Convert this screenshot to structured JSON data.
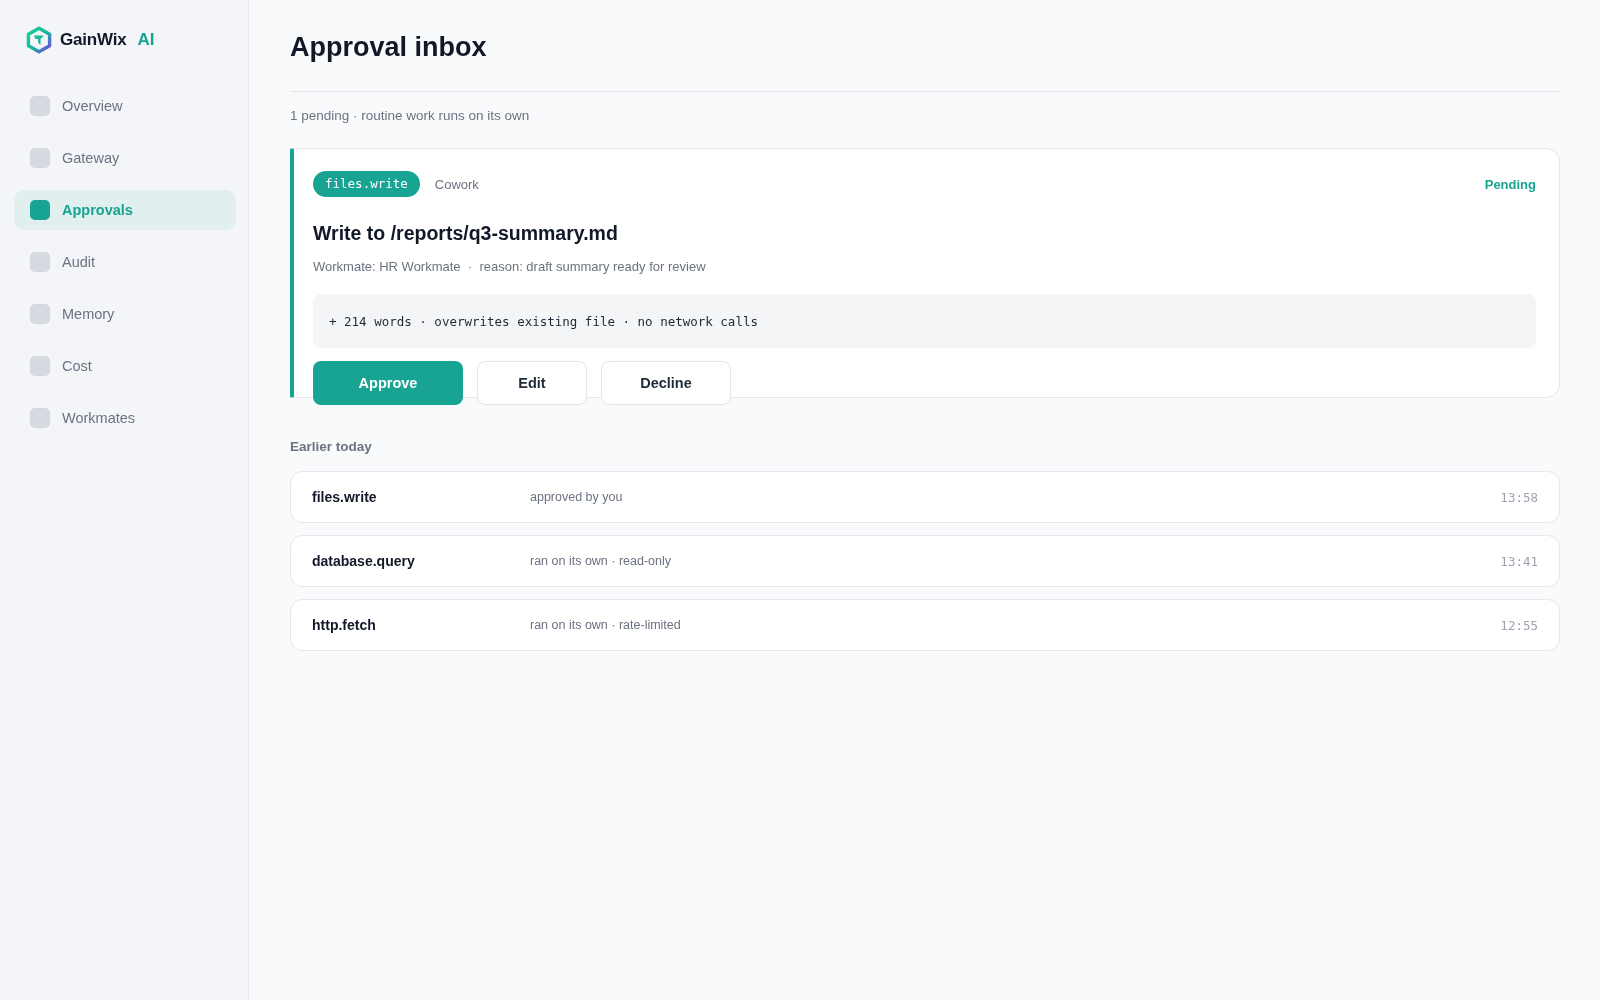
{
  "brand": {
    "name": "GainWix",
    "suffix": "AI"
  },
  "sidebar": {
    "items": [
      {
        "label": "Overview",
        "selected": false
      },
      {
        "label": "Gateway",
        "selected": false
      },
      {
        "label": "Approvals",
        "selected": true
      },
      {
        "label": "Audit",
        "selected": false
      },
      {
        "label": "Memory",
        "selected": false
      },
      {
        "label": "Cost",
        "selected": false
      },
      {
        "label": "Workmates",
        "selected": false
      }
    ]
  },
  "header": {
    "title": "Approval inbox",
    "subtitle": "1 pending · routine work runs on its own"
  },
  "pending_request": {
    "tool": "files.write",
    "source": "Cowork",
    "status": "Pending",
    "title": "Write to /reports/q3-summary.md",
    "meta": "Workmate: HR Workmate  ·  reason: draft summary ready for review",
    "details": "+ 214 words · overwrites existing file · no network calls",
    "actions": [
      {
        "label": "Approve",
        "kind": "primary"
      },
      {
        "label": "Edit",
        "kind": "secondary"
      },
      {
        "label": "Decline",
        "kind": "secondary"
      }
    ]
  },
  "history": {
    "heading": "Earlier today",
    "rows": [
      {
        "tool": "files.write",
        "note": "approved by you",
        "time": "13:58"
      },
      {
        "tool": "database.query",
        "note": "ran on its own · read-only",
        "time": "13:41"
      },
      {
        "tool": "http.fetch",
        "note": "ran on its own · rate-limited",
        "time": "12:55"
      }
    ]
  }
}
